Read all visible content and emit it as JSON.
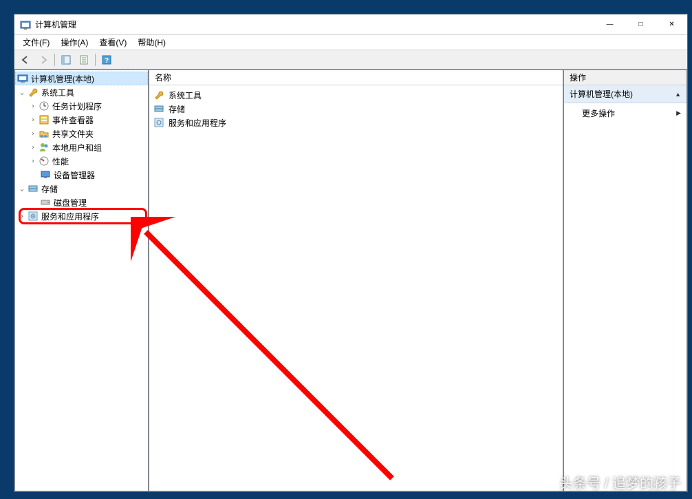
{
  "window": {
    "title": "计算机管理",
    "controls": {
      "min": "—",
      "max": "□",
      "close": "✕"
    }
  },
  "menu": {
    "file": "文件(F)",
    "action": "操作(A)",
    "view": "查看(V)",
    "help": "帮助(H)"
  },
  "tree": {
    "root": "计算机管理(本地)",
    "system_tools": "系统工具",
    "task_scheduler": "任务计划程序",
    "event_viewer": "事件查看器",
    "shared_folders": "共享文件夹",
    "local_users": "本地用户和组",
    "performance": "性能",
    "device_manager": "设备管理器",
    "storage": "存储",
    "disk_mgmt": "磁盘管理",
    "services_apps": "服务和应用程序"
  },
  "list": {
    "header_name": "名称",
    "items": {
      "system_tools": "系统工具",
      "storage": "存储",
      "services_apps": "服务和应用程序"
    }
  },
  "actions": {
    "header": "操作",
    "section": "计算机管理(本地)",
    "more": "更多操作"
  },
  "watermark": "头条号 / 追梦的孩子"
}
